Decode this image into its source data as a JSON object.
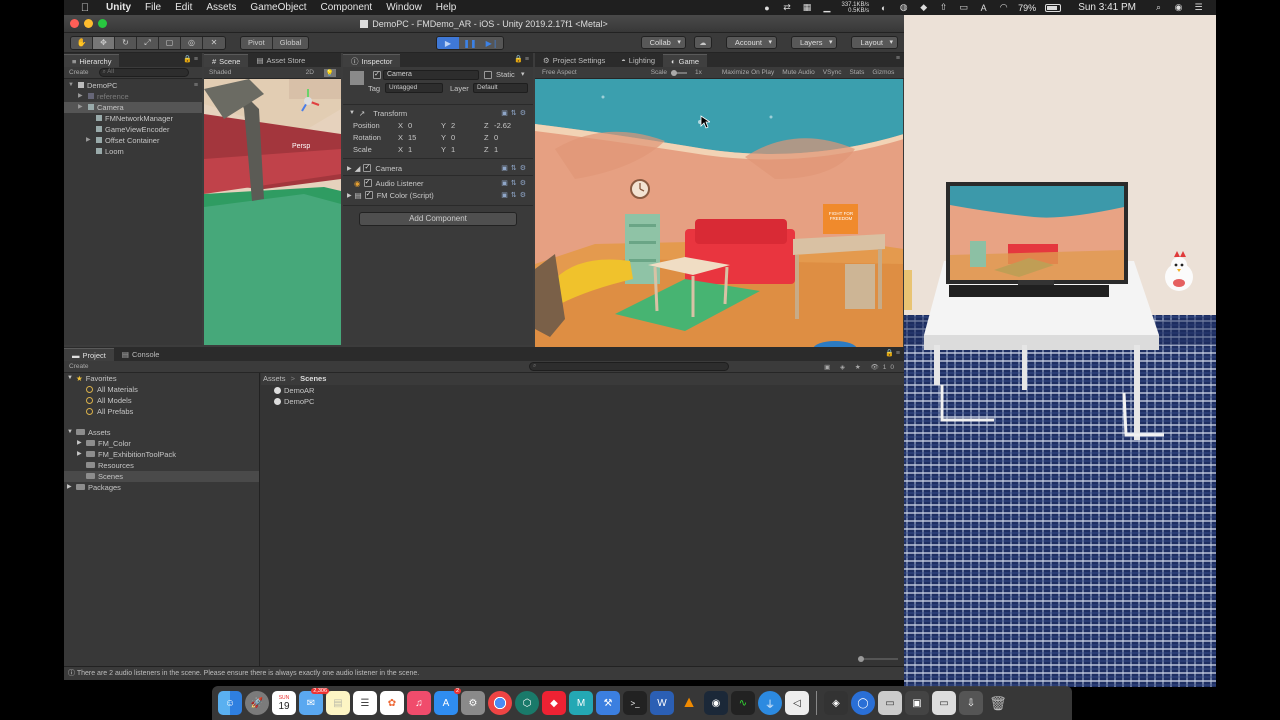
{
  "menubar": {
    "app_name": "Unity",
    "items": [
      "File",
      "Edit",
      "Assets",
      "GameObject",
      "Component",
      "Window",
      "Help"
    ],
    "net_up": "337.1KB/s",
    "net_down": "0.5KB/s",
    "battery": "79%",
    "battery_level": 0.79,
    "clock": "Sun 3:41 PM"
  },
  "window": {
    "title": "DemoPC - FMDemo_AR - iOS - Unity 2019.2.17f1 <Metal>"
  },
  "toolbar": {
    "pivot": "Pivot",
    "global": "Global",
    "collab": "Collab",
    "account": "Account",
    "layers": "Layers",
    "layout": "Layout"
  },
  "hierarchy": {
    "tab": "Hierarchy",
    "create": "Create",
    "search_placeholder": "All",
    "scene_name": "DemoPC",
    "items": [
      {
        "label": "reference"
      },
      {
        "label": "Camera"
      },
      {
        "label": "FMNetworkManager"
      },
      {
        "label": "GameViewEncoder"
      },
      {
        "label": "Offset Container"
      },
      {
        "label": "Loom"
      }
    ]
  },
  "scene": {
    "tab_scene": "Scene",
    "tab_store": "Asset Store",
    "shaded": "Shaded",
    "mode_2d": "2D",
    "persp": "Persp"
  },
  "inspector": {
    "tab": "Inspector",
    "object_name": "Camera",
    "static_label": "Static",
    "tag_label": "Tag",
    "tag_value": "Untagged",
    "layer_label": "Layer",
    "layer_value": "Default",
    "transform_label": "Transform",
    "position_label": "Position",
    "rotation_label": "Rotation",
    "scale_label": "Scale",
    "axis_x": "X",
    "axis_y": "Y",
    "axis_z": "Z",
    "position": {
      "x": "0",
      "y": "2",
      "z": "-2.62"
    },
    "rotation": {
      "x": "15",
      "y": "0",
      "z": "0"
    },
    "scale": {
      "x": "1",
      "y": "1",
      "z": "1"
    },
    "components": [
      "Camera",
      "Audio Listener",
      "FM Color (Script)"
    ],
    "add_component": "Add Component"
  },
  "game": {
    "tab_settings": "Project Settings",
    "tab_lighting": "Lighting",
    "tab_game": "Game",
    "aspect": "Free Aspect",
    "scale_label": "Scale",
    "scale_value": "1x",
    "options": [
      "Maximize On Play",
      "Mute Audio",
      "VSync",
      "Stats",
      "Gizmos"
    ],
    "poster_text": "FIGHT FOR FREEDOM"
  },
  "project": {
    "tab_project": "Project",
    "tab_console": "Console",
    "create": "Create",
    "favorites_label": "Favorites",
    "favorites": [
      "All Materials",
      "All Models",
      "All Prefabs"
    ],
    "assets_label": "Assets",
    "asset_folders": [
      "FM_Color",
      "FM_ExhibitionToolPack",
      "Resources",
      "Scenes"
    ],
    "packages_label": "Packages",
    "breadcrumb_root": "Assets",
    "breadcrumb_current": "Scenes",
    "files": [
      "DemoAR",
      "DemoPC"
    ],
    "slider_count": "10"
  },
  "status": {
    "message": "There are 2 audio listeners in the scene. Please ensure there is always exactly one audio listener in the scene."
  },
  "dock": {
    "calendar_day": "19",
    "mail_badge": "2,306",
    "appstore_badge": "2",
    "word_label": "W",
    "maya_label": "M"
  }
}
